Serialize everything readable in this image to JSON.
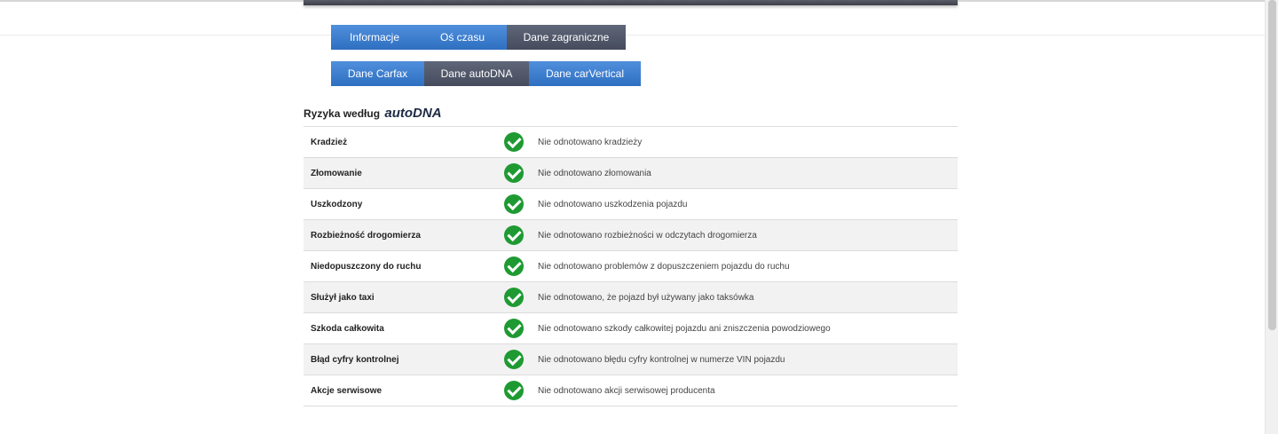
{
  "tabs_row1": [
    {
      "label": "Informacje",
      "active": false
    },
    {
      "label": "Oś czasu",
      "active": false
    },
    {
      "label": "Dane zagraniczne",
      "active": true
    }
  ],
  "tabs_row2": [
    {
      "label": "Dane Carfax",
      "active": false
    },
    {
      "label": "Dane autoDNA",
      "active": true
    },
    {
      "label": "Dane carVertical",
      "active": false
    }
  ],
  "section": {
    "title": "Ryzyka według",
    "brand": "autoDNA"
  },
  "risks": [
    {
      "label": "Kradzież",
      "status": "ok",
      "description": "Nie odnotowano kradzieży"
    },
    {
      "label": "Złomowanie",
      "status": "ok",
      "description": "Nie odnotowano złomowania"
    },
    {
      "label": "Uszkodzony",
      "status": "ok",
      "description": "Nie odnotowano uszkodzenia pojazdu"
    },
    {
      "label": "Rozbieżność drogomierza",
      "status": "ok",
      "description": "Nie odnotowano rozbieżności w odczytach drogomierza"
    },
    {
      "label": "Niedopuszczony do ruchu",
      "status": "ok",
      "description": "Nie odnotowano problemów z dopuszczeniem pojazdu do ruchu"
    },
    {
      "label": "Służył jako taxi",
      "status": "ok",
      "description": "Nie odnotowano, że pojazd był używany jako taksówka"
    },
    {
      "label": "Szkoda całkowita",
      "status": "ok",
      "description": "Nie odnotowano szkody całkowitej pojazdu ani zniszczenia powodziowego"
    },
    {
      "label": "Błąd cyfry kontrolnej",
      "status": "ok",
      "description": "Nie odnotowano błędu cyfry kontrolnej w numerze VIN pojazdu"
    },
    {
      "label": "Akcje serwisowe",
      "status": "ok",
      "description": "Nie odnotowano akcji serwisowej producenta"
    }
  ],
  "colors": {
    "tab_blue": "#3f7fd0",
    "tab_active": "#555b6c",
    "check_green": "#1f9a33"
  },
  "icons": {
    "status_ok": "check-circle-icon"
  }
}
